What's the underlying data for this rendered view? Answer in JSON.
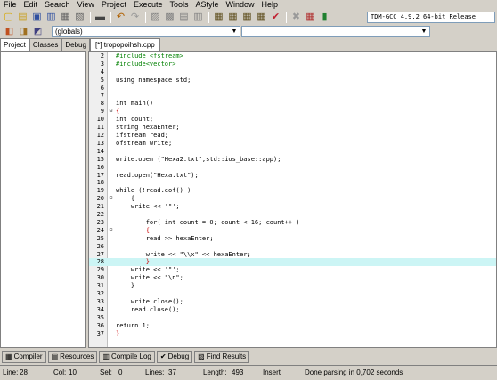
{
  "menu": [
    "File",
    "Edit",
    "Search",
    "View",
    "Project",
    "Execute",
    "Tools",
    "AStyle",
    "Window",
    "Help"
  ],
  "toolbar": {
    "compiler": "TDM-GCC 4.9.2 64-bit Release",
    "icons": [
      "new-file-icon",
      "open-icon",
      "save-icon",
      "save-all-icon",
      "close-icon",
      "close-all-icon",
      "print-icon",
      "undo-icon",
      "redo-icon",
      "find-icon",
      "replace-icon",
      "find-next-icon",
      "goto-icon",
      "compile-icon",
      "run-icon",
      "compile-run-icon",
      "rebuild-icon",
      "syntax-check-icon",
      "stop-icon",
      "profile-icon",
      "chart-icon"
    ]
  },
  "toolbar2": {
    "scope": "(globals)",
    "members": ""
  },
  "left_tabs": [
    "Project",
    "Classes",
    "Debug"
  ],
  "file_tab": "[*] tropopoihsh.cpp",
  "code": [
    {
      "n": "2",
      "fold": "",
      "text": "#include <fstream>",
      "style": "pre"
    },
    {
      "n": "3",
      "fold": "",
      "text": "#include<vector>",
      "style": "pre"
    },
    {
      "n": "4",
      "fold": "",
      "text": "",
      "style": "plain"
    },
    {
      "n": "5",
      "fold": "",
      "text": "using namespace std;",
      "style": "plain"
    },
    {
      "n": "6",
      "fold": "",
      "text": "",
      "style": "plain"
    },
    {
      "n": "7",
      "fold": "",
      "text": "",
      "style": "plain"
    },
    {
      "n": "8",
      "fold": "",
      "text": "int main()",
      "style": "plain"
    },
    {
      "n": "9",
      "fold": "⊟",
      "text": "{",
      "style": "red"
    },
    {
      "n": "10",
      "fold": "",
      "text": "int count;",
      "style": "plain"
    },
    {
      "n": "11",
      "fold": "",
      "text": "string hexaEnter;",
      "style": "plain"
    },
    {
      "n": "12",
      "fold": "",
      "text": "ifstream read;",
      "style": "plain"
    },
    {
      "n": "13",
      "fold": "",
      "text": "ofstream write;",
      "style": "plain"
    },
    {
      "n": "14",
      "fold": "",
      "text": "",
      "style": "plain"
    },
    {
      "n": "15",
      "fold": "",
      "text": "write.open (\"Hexa2.txt\",std::ios_base::app);",
      "style": "plain"
    },
    {
      "n": "16",
      "fold": "",
      "text": "",
      "style": "plain"
    },
    {
      "n": "17",
      "fold": "",
      "text": "read.open(\"Hexa.txt\");",
      "style": "plain"
    },
    {
      "n": "18",
      "fold": "",
      "text": "",
      "style": "plain"
    },
    {
      "n": "19",
      "fold": "",
      "text": "while (!read.eof() )",
      "style": "plain"
    },
    {
      "n": "20",
      "fold": "⊟",
      "text": "    {",
      "style": "plain"
    },
    {
      "n": "21",
      "fold": "",
      "text": "    write << '\"';",
      "style": "plain"
    },
    {
      "n": "22",
      "fold": "",
      "text": "",
      "style": "plain"
    },
    {
      "n": "23",
      "fold": "",
      "text": "        for( int count = 0; count < 16; count++ )",
      "style": "plain"
    },
    {
      "n": "24",
      "fold": "⊟",
      "text": "        {",
      "style": "red"
    },
    {
      "n": "25",
      "fold": "",
      "text": "        read >> hexaEnter;",
      "style": "plain"
    },
    {
      "n": "26",
      "fold": "",
      "text": "",
      "style": "plain"
    },
    {
      "n": "27",
      "fold": "",
      "text": "        write << \"\\\\x\" << hexaEnter;",
      "style": "plain"
    },
    {
      "n": "28",
      "fold": "",
      "text": "        }",
      "style": "red"
    },
    {
      "n": "29",
      "fold": "",
      "text": "    write << '\"';",
      "style": "plain"
    },
    {
      "n": "30",
      "fold": "",
      "text": "    write << \"\\n\";",
      "style": "plain"
    },
    {
      "n": "31",
      "fold": "",
      "text": "    }",
      "style": "plain"
    },
    {
      "n": "32",
      "fold": "",
      "text": "",
      "style": "plain"
    },
    {
      "n": "33",
      "fold": "",
      "text": "    write.close();",
      "style": "plain"
    },
    {
      "n": "34",
      "fold": "",
      "text": "    read.close();",
      "style": "plain"
    },
    {
      "n": "35",
      "fold": "",
      "text": "",
      "style": "plain"
    },
    {
      "n": "36",
      "fold": "",
      "text": "return 1;",
      "style": "plain"
    },
    {
      "n": "37",
      "fold": "",
      "text": "}",
      "style": "red"
    }
  ],
  "highlight_line": "28",
  "bottom_tabs": [
    {
      "icon": "compiler-icon",
      "glyph": "▦",
      "label": "Compiler"
    },
    {
      "icon": "resources-icon",
      "glyph": "▤",
      "label": "Resources"
    },
    {
      "icon": "compile-log-icon",
      "glyph": "▥",
      "label": "Compile Log"
    },
    {
      "icon": "debug-icon",
      "glyph": "✔",
      "label": "Debug"
    },
    {
      "icon": "find-results-icon",
      "glyph": "▧",
      "label": "Find Results"
    }
  ],
  "status": {
    "line_label": "Line:",
    "line": "28",
    "col_label": "Col:",
    "col": "10",
    "sel_label": "Sel:",
    "sel": "0",
    "lines_label": "Lines:",
    "lines": "37",
    "length_label": "Length:",
    "length": "493",
    "mode": "Insert",
    "message": "Done parsing in 0,702 seconds"
  },
  "colors": {
    "preprocessor": "#008000",
    "brace_match": "#cc0000",
    "current_line": "#ccf5f5"
  }
}
